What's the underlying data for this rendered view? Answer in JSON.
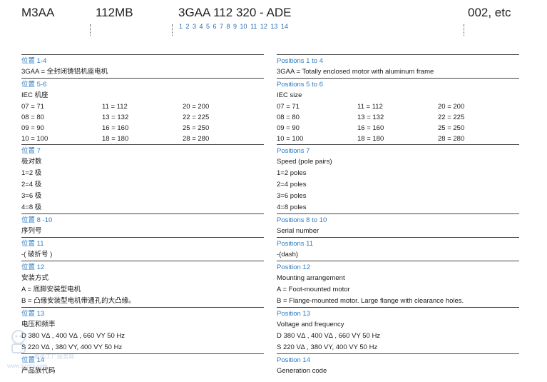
{
  "header": {
    "model": "M3AA",
    "frame": "112MB",
    "code": "3GAA 112 320 - ADE",
    "suffix": "002, etc",
    "position_digits": "1 2 3 4   5 6 7 8 9 10 11 12 13 14"
  },
  "left": {
    "s1": {
      "title": "位置 1-4",
      "lines": [
        "3GAA = 全封闭铸铝机座电机"
      ]
    },
    "s2": {
      "title": "位置 5-6",
      "sub": "IEC 机座"
    },
    "s3": {
      "title": "位置 7",
      "lines": [
        "极对数",
        "1=2 极",
        "2=4 极",
        "3=6 极",
        "4=8 极"
      ]
    },
    "s4": {
      "title": "位置 8 -10",
      "lines": [
        "序列号"
      ]
    },
    "s5": {
      "title": "位置 11",
      "lines": [
        "-( 破折号 )"
      ]
    },
    "s6": {
      "title": "位置 12",
      "lines": [
        "安装方式",
        "A = 底脚安装型电机",
        "B = 凸缘安装型电机带通孔的大凸缘。"
      ]
    },
    "s7": {
      "title": "位置 13",
      "lines": [
        "电压和频率",
        "D   380 V∆ , 400 V∆ , 660 VY 50 Hz",
        "S   220 V∆ , 380 VY, 400 VY 50 Hz"
      ]
    },
    "s8": {
      "title": "位置 14",
      "lines": [
        "产品族代码"
      ]
    }
  },
  "right": {
    "s1": {
      "title": "Positions 1 to 4",
      "lines": [
        "3GAA = Totally enclosed motor with aluminum frame"
      ]
    },
    "s2": {
      "title": "Positions 5 to 6",
      "sub": "IEC size"
    },
    "s3": {
      "title": "Positions 7",
      "lines": [
        "Speed (pole pairs)",
        "1=2 poles",
        "2=4 poles",
        "3=6 poles",
        "4=8 poles"
      ]
    },
    "s4": {
      "title": "Positions 8 to 10",
      "lines": [
        "Serial number"
      ]
    },
    "s5": {
      "title": "Positions 11",
      "lines": [
        "-(dash)"
      ]
    },
    "s6": {
      "title": "Position 12",
      "lines": [
        "Mounting arrangement",
        "A = Foot-mounted motor",
        "B = Flange-mounted motor. Large flange with clearance holes."
      ]
    },
    "s7": {
      "title": "Position 13",
      "lines": [
        "Voltage and frequency",
        "D   380 V∆ , 400 V∆ , 660 VY 50 Hz",
        "S   220 V∆ , 380 VY, 400 VY 50 Hz"
      ]
    },
    "s8": {
      "title": "Position 14",
      "lines": [
        "Generation code"
      ]
    }
  },
  "iec_table": [
    [
      "07 = 71",
      "11 = 112",
      "20 = 200"
    ],
    [
      "08 = 80",
      "13 = 132",
      "22 = 225"
    ],
    [
      "09 = 90",
      "16 = 160",
      "25 = 250"
    ],
    [
      "10 = 100",
      "18 = 180",
      "28 = 280"
    ]
  ],
  "watermark": {
    "text": "智能工厂服务商",
    "url": "www.ljjoshi.com"
  },
  "colors": {
    "heading_blue": "#2b7bc4",
    "rule": "#444444"
  }
}
